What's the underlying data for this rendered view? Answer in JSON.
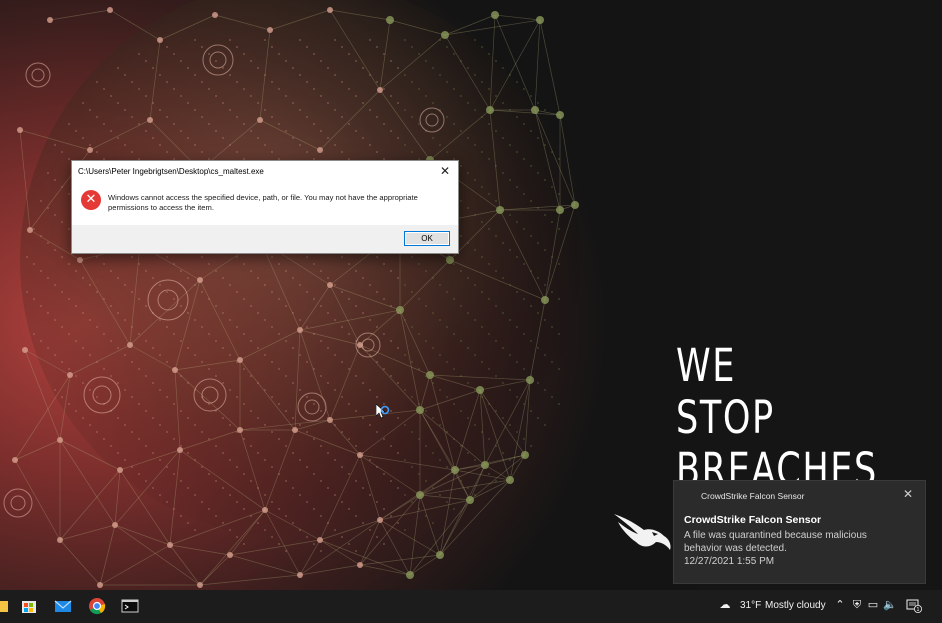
{
  "wallpaper": {
    "slogan_lines": [
      "WE",
      "STOP",
      "BREACHES"
    ]
  },
  "dialog": {
    "title": "C:\\Users\\Peter Ingebrigtsen\\Desktop\\cs_maltest.exe",
    "message": "Windows cannot access the specified device, path, or file. You may not have the appropriate permissions to access the item.",
    "ok_label": "OK",
    "close_glyph": "✕",
    "icon": "error-icon"
  },
  "toast": {
    "app_name": "CrowdStrike Falcon Sensor",
    "title": "CrowdStrike Falcon Sensor",
    "body": "A file was quarantined because malicious behavior was detected.",
    "timestamp": "12/27/2021 1:55 PM",
    "close_glyph": "✕"
  },
  "taskbar": {
    "apps": [
      "file-explorer-icon",
      "store-icon",
      "mail-icon",
      "chrome-icon",
      "terminal-icon"
    ],
    "weather": {
      "temp": "31°F",
      "condition": "Mostly cloudy",
      "icon": "weather-cloudy-icon"
    },
    "tray": [
      "chevron-up-icon",
      "shield-icon",
      "network-icon",
      "volume-icon"
    ],
    "notification_count": "1",
    "accent": "#0078d7"
  }
}
